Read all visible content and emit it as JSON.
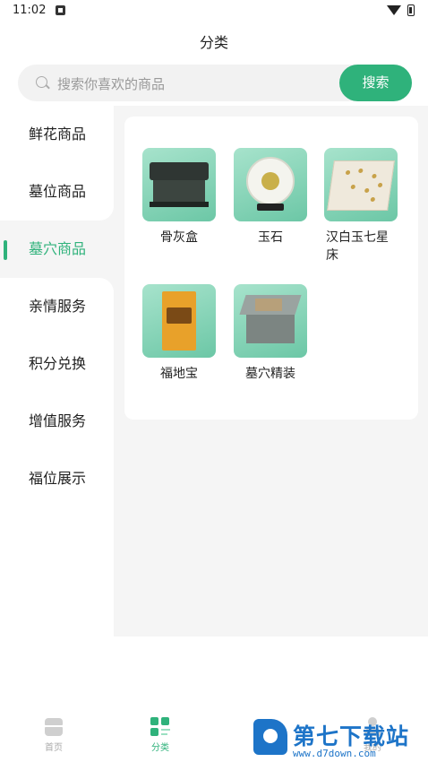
{
  "status_bar": {
    "time": "11:02"
  },
  "header": {
    "title": "分类"
  },
  "search": {
    "placeholder": "搜索你喜欢的商品",
    "button_label": "搜索"
  },
  "sidebar": {
    "items": [
      {
        "label": "鲜花商品"
      },
      {
        "label": "墓位商品"
      },
      {
        "label": "墓穴商品",
        "active": true
      },
      {
        "label": "亲情服务"
      },
      {
        "label": "积分兑换"
      },
      {
        "label": "增值服务"
      },
      {
        "label": "福位展示"
      }
    ]
  },
  "products": [
    {
      "label": "骨灰盒"
    },
    {
      "label": "玉石"
    },
    {
      "label": "汉白玉七星床"
    },
    {
      "label": "福地宝"
    },
    {
      "label": "墓穴精装"
    }
  ],
  "tabbar": {
    "items": [
      {
        "label": "首页",
        "icon": "home-icon"
      },
      {
        "label": "分类",
        "icon": "category-icon",
        "active": true
      },
      {
        "label": "我的",
        "icon": "user-icon"
      }
    ]
  },
  "watermark": {
    "text": "第七下载站",
    "url": "www.d7down.com"
  },
  "colors": {
    "accent": "#2fb27b",
    "panel_bg": "#f5f5f5",
    "watermark": "#1d74c8"
  }
}
